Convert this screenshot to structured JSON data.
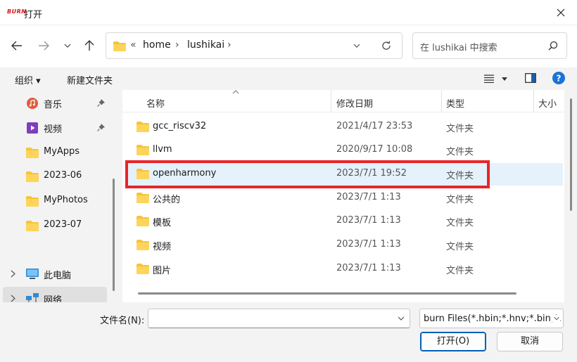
{
  "window": {
    "title": "打开",
    "logo_text": "BURN"
  },
  "nav": {
    "path": [
      "«",
      "home",
      "lushikai"
    ],
    "search_placeholder": "在 lushikai 中搜索"
  },
  "toolbar": {
    "organize": "组织 ▾",
    "new_folder": "新建文件夹"
  },
  "sidebar": {
    "items": [
      {
        "label": "音乐",
        "icon": "music-icon"
      },
      {
        "label": "视频",
        "icon": "video-icon"
      },
      {
        "label": "MyApps",
        "icon": "folder-icon"
      },
      {
        "label": "2023-06",
        "icon": "folder-icon"
      },
      {
        "label": "MyPhotos",
        "icon": "folder-icon"
      },
      {
        "label": "2023-07",
        "icon": "folder-icon"
      },
      {
        "label": "此电脑",
        "icon": "computer-icon"
      },
      {
        "label": "网络",
        "icon": "network-icon"
      }
    ]
  },
  "list": {
    "columns": {
      "name": "名称",
      "date": "修改日期",
      "type": "类型",
      "size": "大小"
    },
    "rows": [
      {
        "name": "gcc_riscv32",
        "date": "2021/4/17 23:53",
        "type": "文件夹"
      },
      {
        "name": "llvm",
        "date": "2020/9/17 10:08",
        "type": "文件夹"
      },
      {
        "name": "openharmony",
        "date": "2023/7/1 19:52",
        "type": "文件夹",
        "selected": true
      },
      {
        "name": "公共的",
        "date": "2023/7/1 1:13",
        "type": "文件夹"
      },
      {
        "name": "模板",
        "date": "2023/7/1 1:13",
        "type": "文件夹"
      },
      {
        "name": "视频",
        "date": "2023/7/1 1:13",
        "type": "文件夹"
      },
      {
        "name": "图片",
        "date": "2023/7/1 1:13",
        "type": "文件夹"
      }
    ]
  },
  "footer": {
    "filename_label": "文件名(N):",
    "filename_value": "",
    "filter_value": "burn Files(*.hbin;*.hnv;*.bin;*.",
    "open_label": "打开(O)",
    "cancel_label": "取消"
  },
  "colors": {
    "highlight": "#e8262a",
    "selection": "#e5f1fb",
    "folder": "#f8c33a",
    "accent": "#005fb8"
  }
}
